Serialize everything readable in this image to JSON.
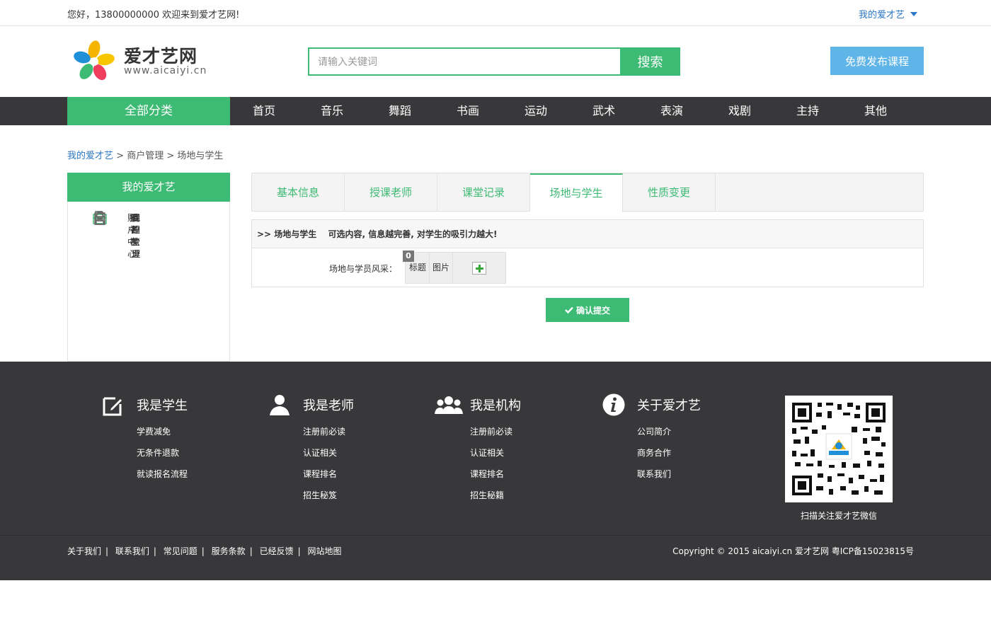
{
  "topbar": {
    "greeting": "您好，13800000000 欢迎来到爱才艺网!",
    "my_menu": "我的爱才艺"
  },
  "header": {
    "logo_name": "爱才艺网",
    "logo_url": "www.aicaiyi.cn",
    "search_placeholder": "请输入关键词",
    "search_button": "搜索",
    "publish_button": "免费发布课程"
  },
  "nav": {
    "all_categories": "全部分类",
    "items": [
      "首页",
      "音乐",
      "舞蹈",
      "书画",
      "运动",
      "武术",
      "表演",
      "戏剧",
      "主持",
      "其他"
    ]
  },
  "breadcrumb": {
    "home": "我的爱才艺",
    "sep": ">",
    "level2": "商户管理",
    "level3": "场地与学生"
  },
  "sidebar": {
    "title": "我的爱才艺",
    "items": [
      {
        "label": "我的主页",
        "icon": "home-icon"
      },
      {
        "label": "商户管理",
        "icon": "briefcase-icon"
      },
      {
        "label": "课程管理",
        "icon": "document-icon"
      },
      {
        "label": "报名表",
        "icon": "clipboard-icon"
      },
      {
        "label": "账户中心",
        "icon": "user-icon"
      }
    ]
  },
  "tabs": [
    "基本信息",
    "授课老师",
    "课堂记录",
    "场地与学生",
    "性质变更"
  ],
  "panel": {
    "head_prefix": ">> 场地与学生",
    "head_tip": "可选内容, 信息越完善, 对学生的吸引力越大!",
    "row_label": "场地与学员风采：",
    "badge": "0",
    "col_title": "标题",
    "col_image": "图片"
  },
  "submit_button": "确认提交",
  "footer": {
    "columns": [
      {
        "title": "我是学生",
        "icon": "edit-icon",
        "links": [
          "学费减免",
          "无条件退款",
          "就读报名流程"
        ]
      },
      {
        "title": "我是老师",
        "icon": "teacher-icon",
        "links": [
          "注册前必读",
          "认证相关",
          "课程排名",
          "招生秘笈"
        ]
      },
      {
        "title": "我是机构",
        "icon": "group-icon",
        "links": [
          "注册前必读",
          "认证相关",
          "课程排名",
          "招生秘籍"
        ]
      },
      {
        "title": "关于爱才艺",
        "icon": "info-icon",
        "links": [
          "公司简介",
          "商务合作",
          "联系我们"
        ]
      }
    ],
    "qr_caption": "扫描关注爱才艺微信",
    "bottom_links": [
      "关于我们",
      "联系我们",
      "常见问题",
      "服务条款",
      "已经反馈",
      "网站地图"
    ],
    "link_sep": "|",
    "copyright": "Copyright © 2015 aicaiyi.cn 爱才艺网 粤ICP备15023815号"
  },
  "colors": {
    "accent_green": "#3dba73",
    "nav_dark": "#38383a",
    "link_blue": "#2a77c5",
    "publish_blue": "#5fb4e8"
  }
}
